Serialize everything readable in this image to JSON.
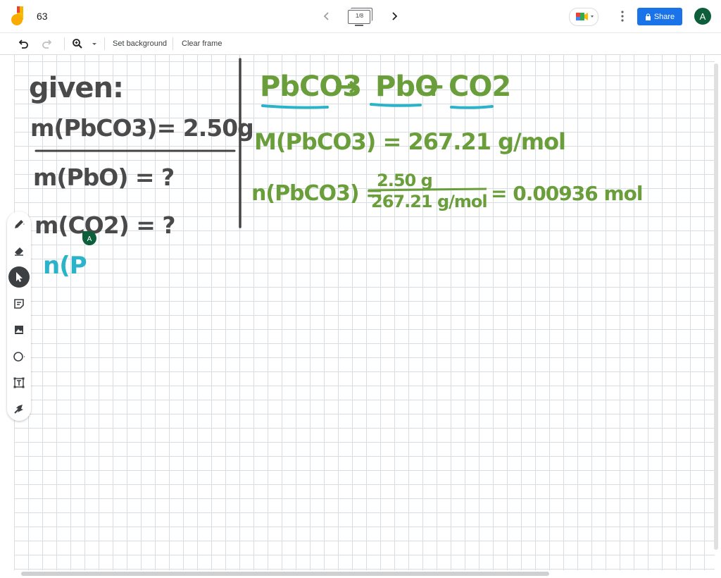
{
  "header": {
    "title": "63",
    "frame_counter": "1/8",
    "share_label": "Share",
    "avatar_initial": "A"
  },
  "toolbar": {
    "set_background_label": "Set background",
    "clear_frame_label": "Clear frame"
  },
  "board": {
    "given_label": "given:",
    "given_mass": "m(PbCO3)= 2.50g",
    "find_pbo": "m(PbO) = ?",
    "find_co2": "m(CO2) = ?",
    "partial_n": "n(P",
    "equation_reactant": "PbCO3",
    "equation_arrow": "→",
    "equation_product1": "PbO",
    "equation_plus": "+",
    "equation_product2": "CO2",
    "molar_mass": "M(PbCO3) = 267.21 g/mol",
    "moles_lhs": "n(PbCO3) =",
    "moles_numerator": "2.50 g",
    "moles_denominator": "267.21 g/mol",
    "moles_result": "= 0.00936 mol"
  },
  "colors": {
    "share_blue": "#1a73e8",
    "avatar_green": "#0d5e3a",
    "ink_gray": "#4a4a4a",
    "ink_green": "#6a9e3a",
    "ink_teal": "#2bb3c9"
  },
  "cursor_badge_initial": "A",
  "icons": {
    "logo": "jamboard-logo",
    "undo": "undo-icon",
    "redo": "redo-icon",
    "zoom": "zoom-icon",
    "pen": "pen-icon",
    "eraser": "eraser-icon",
    "select": "select-cursor-icon",
    "sticky_note": "sticky-note-icon",
    "image": "image-icon",
    "circle": "circle-icon",
    "text_box": "text-box-icon",
    "laser": "laser-icon"
  }
}
